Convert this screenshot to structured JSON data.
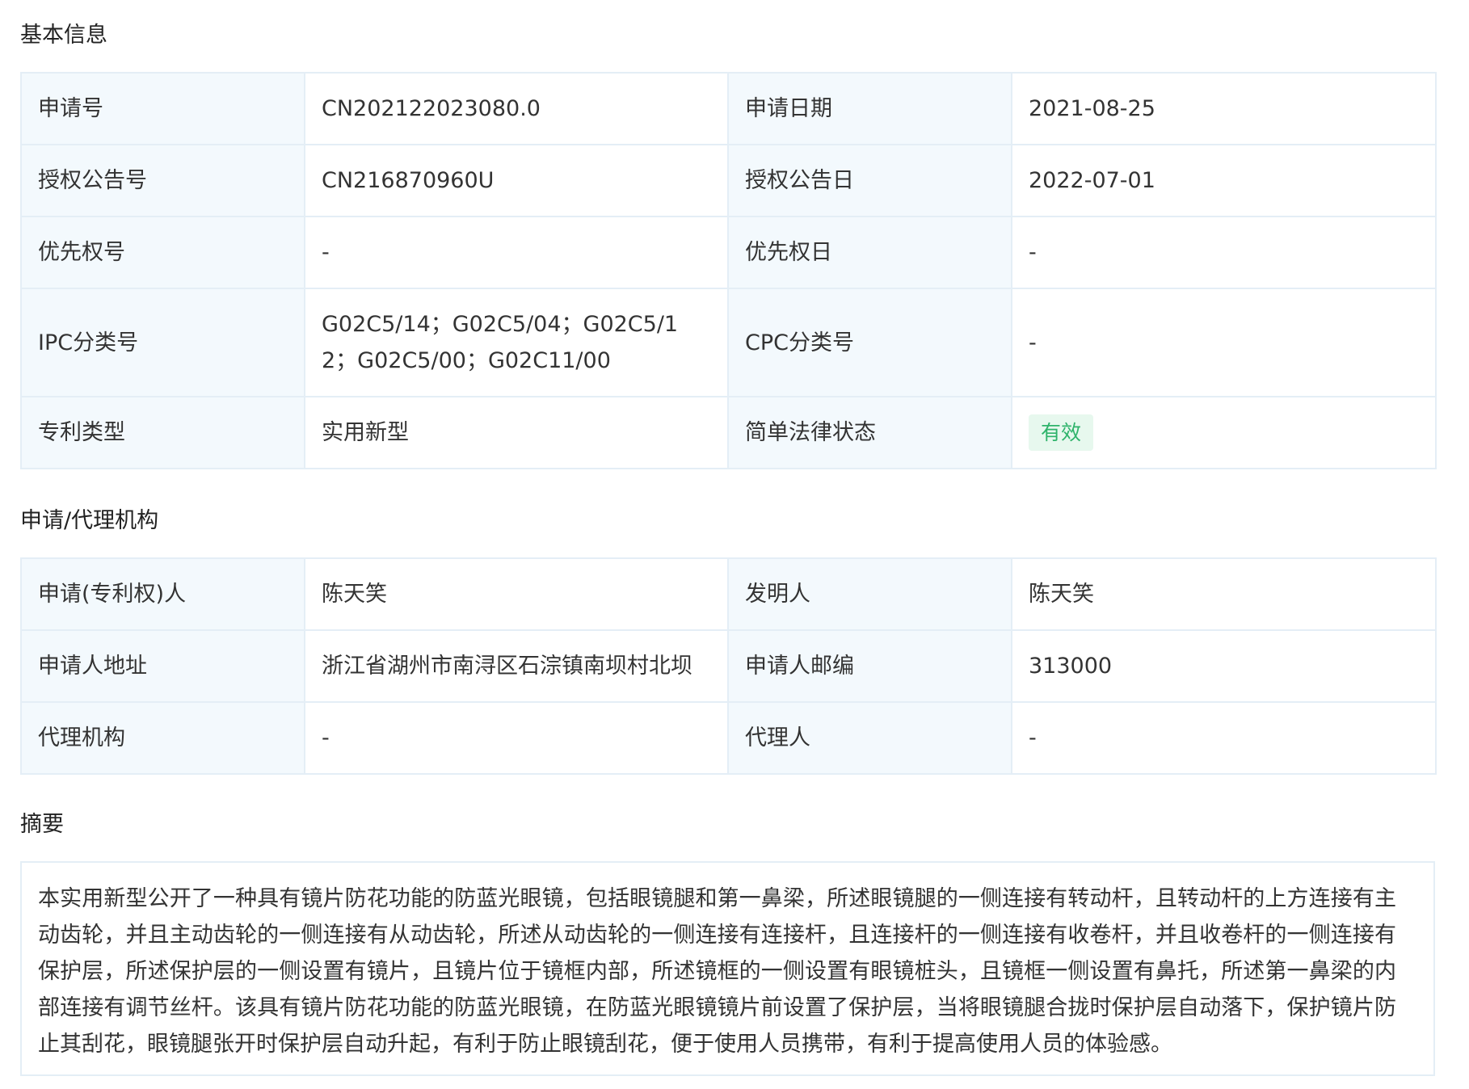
{
  "basic_info": {
    "title": "基本信息",
    "rows": [
      {
        "label1": "申请号",
        "value1": "CN202122023080.0",
        "label2": "申请日期",
        "value2": "2021-08-25"
      },
      {
        "label1": "授权公告号",
        "value1": "CN216870960U",
        "label2": "授权公告日",
        "value2": "2022-07-01"
      },
      {
        "label1": "优先权号",
        "value1": "-",
        "label2": "优先权日",
        "value2": "-"
      },
      {
        "label1": "IPC分类号",
        "value1": "G02C5/14；G02C5/04；G02C5/12；G02C5/00；G02C11/00",
        "label2": "CPC分类号",
        "value2": "-"
      },
      {
        "label1": "专利类型",
        "value1": "实用新型",
        "label2": "简单法律状态",
        "value2": "有效"
      }
    ],
    "status_badge_color": "#2fb36b",
    "status_badge_bg": "#e7f8ee"
  },
  "org_info": {
    "title": "申请/代理机构",
    "rows": [
      {
        "label1": "申请(专利权)人",
        "value1": "陈天笑",
        "label2": "发明人",
        "value2": "陈天笑"
      },
      {
        "label1": "申请人地址",
        "value1": "浙江省湖州市南浔区石淙镇南坝村北坝",
        "label2": "申请人邮编",
        "value2": "313000"
      },
      {
        "label1": "代理机构",
        "value1": "-",
        "label2": "代理人",
        "value2": "-"
      }
    ]
  },
  "abstract": {
    "title": "摘要",
    "text": "本实用新型公开了一种具有镜片防花功能的防蓝光眼镜，包括眼镜腿和第一鼻梁，所述眼镜腿的一侧连接有转动杆，且转动杆的上方连接有主动齿轮，并且主动齿轮的一侧连接有从动齿轮，所述从动齿轮的一侧连接有连接杆，且连接杆的一侧连接有收卷杆，并且收卷杆的一侧连接有保护层，所述保护层的一侧设置有镜片，且镜片位于镜框内部，所述镜框的一侧设置有眼镜桩头，且镜框一侧设置有鼻托，所述第一鼻梁的内部连接有调节丝杆。该具有镜片防花功能的防蓝光眼镜，在防蓝光眼镜镜片前设置了保护层，当将眼镜腿合拢时保护层自动落下，保护镜片防止其刮花，眼镜腿张开时保护层自动升起，有利于防止眼镜刮花，便于使用人员携带，有利于提高使用人员的体验感。"
  }
}
